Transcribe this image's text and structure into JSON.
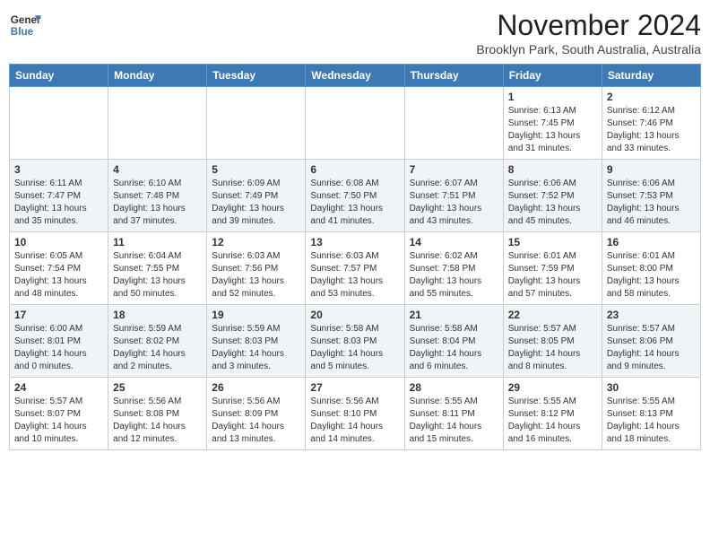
{
  "header": {
    "logo_line1": "General",
    "logo_line2": "Blue",
    "month": "November 2024",
    "location": "Brooklyn Park, South Australia, Australia"
  },
  "weekdays": [
    "Sunday",
    "Monday",
    "Tuesday",
    "Wednesday",
    "Thursday",
    "Friday",
    "Saturday"
  ],
  "weeks": [
    [
      {
        "day": "",
        "info": ""
      },
      {
        "day": "",
        "info": ""
      },
      {
        "day": "",
        "info": ""
      },
      {
        "day": "",
        "info": ""
      },
      {
        "day": "",
        "info": ""
      },
      {
        "day": "1",
        "info": "Sunrise: 6:13 AM\nSunset: 7:45 PM\nDaylight: 13 hours\nand 31 minutes."
      },
      {
        "day": "2",
        "info": "Sunrise: 6:12 AM\nSunset: 7:46 PM\nDaylight: 13 hours\nand 33 minutes."
      }
    ],
    [
      {
        "day": "3",
        "info": "Sunrise: 6:11 AM\nSunset: 7:47 PM\nDaylight: 13 hours\nand 35 minutes."
      },
      {
        "day": "4",
        "info": "Sunrise: 6:10 AM\nSunset: 7:48 PM\nDaylight: 13 hours\nand 37 minutes."
      },
      {
        "day": "5",
        "info": "Sunrise: 6:09 AM\nSunset: 7:49 PM\nDaylight: 13 hours\nand 39 minutes."
      },
      {
        "day": "6",
        "info": "Sunrise: 6:08 AM\nSunset: 7:50 PM\nDaylight: 13 hours\nand 41 minutes."
      },
      {
        "day": "7",
        "info": "Sunrise: 6:07 AM\nSunset: 7:51 PM\nDaylight: 13 hours\nand 43 minutes."
      },
      {
        "day": "8",
        "info": "Sunrise: 6:06 AM\nSunset: 7:52 PM\nDaylight: 13 hours\nand 45 minutes."
      },
      {
        "day": "9",
        "info": "Sunrise: 6:06 AM\nSunset: 7:53 PM\nDaylight: 13 hours\nand 46 minutes."
      }
    ],
    [
      {
        "day": "10",
        "info": "Sunrise: 6:05 AM\nSunset: 7:54 PM\nDaylight: 13 hours\nand 48 minutes."
      },
      {
        "day": "11",
        "info": "Sunrise: 6:04 AM\nSunset: 7:55 PM\nDaylight: 13 hours\nand 50 minutes."
      },
      {
        "day": "12",
        "info": "Sunrise: 6:03 AM\nSunset: 7:56 PM\nDaylight: 13 hours\nand 52 minutes."
      },
      {
        "day": "13",
        "info": "Sunrise: 6:03 AM\nSunset: 7:57 PM\nDaylight: 13 hours\nand 53 minutes."
      },
      {
        "day": "14",
        "info": "Sunrise: 6:02 AM\nSunset: 7:58 PM\nDaylight: 13 hours\nand 55 minutes."
      },
      {
        "day": "15",
        "info": "Sunrise: 6:01 AM\nSunset: 7:59 PM\nDaylight: 13 hours\nand 57 minutes."
      },
      {
        "day": "16",
        "info": "Sunrise: 6:01 AM\nSunset: 8:00 PM\nDaylight: 13 hours\nand 58 minutes."
      }
    ],
    [
      {
        "day": "17",
        "info": "Sunrise: 6:00 AM\nSunset: 8:01 PM\nDaylight: 14 hours\nand 0 minutes."
      },
      {
        "day": "18",
        "info": "Sunrise: 5:59 AM\nSunset: 8:02 PM\nDaylight: 14 hours\nand 2 minutes."
      },
      {
        "day": "19",
        "info": "Sunrise: 5:59 AM\nSunset: 8:03 PM\nDaylight: 14 hours\nand 3 minutes."
      },
      {
        "day": "20",
        "info": "Sunrise: 5:58 AM\nSunset: 8:03 PM\nDaylight: 14 hours\nand 5 minutes."
      },
      {
        "day": "21",
        "info": "Sunrise: 5:58 AM\nSunset: 8:04 PM\nDaylight: 14 hours\nand 6 minutes."
      },
      {
        "day": "22",
        "info": "Sunrise: 5:57 AM\nSunset: 8:05 PM\nDaylight: 14 hours\nand 8 minutes."
      },
      {
        "day": "23",
        "info": "Sunrise: 5:57 AM\nSunset: 8:06 PM\nDaylight: 14 hours\nand 9 minutes."
      }
    ],
    [
      {
        "day": "24",
        "info": "Sunrise: 5:57 AM\nSunset: 8:07 PM\nDaylight: 14 hours\nand 10 minutes."
      },
      {
        "day": "25",
        "info": "Sunrise: 5:56 AM\nSunset: 8:08 PM\nDaylight: 14 hours\nand 12 minutes."
      },
      {
        "day": "26",
        "info": "Sunrise: 5:56 AM\nSunset: 8:09 PM\nDaylight: 14 hours\nand 13 minutes."
      },
      {
        "day": "27",
        "info": "Sunrise: 5:56 AM\nSunset: 8:10 PM\nDaylight: 14 hours\nand 14 minutes."
      },
      {
        "day": "28",
        "info": "Sunrise: 5:55 AM\nSunset: 8:11 PM\nDaylight: 14 hours\nand 15 minutes."
      },
      {
        "day": "29",
        "info": "Sunrise: 5:55 AM\nSunset: 8:12 PM\nDaylight: 14 hours\nand 16 minutes."
      },
      {
        "day": "30",
        "info": "Sunrise: 5:55 AM\nSunset: 8:13 PM\nDaylight: 14 hours\nand 18 minutes."
      }
    ]
  ]
}
